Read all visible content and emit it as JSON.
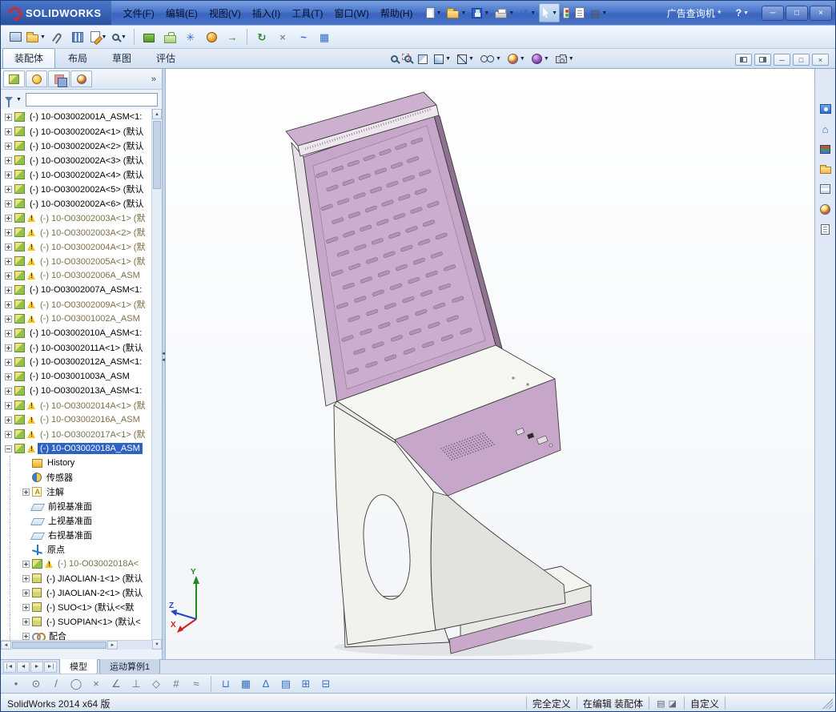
{
  "window": {
    "brand": "SOLIDWORKS",
    "doc_title": "广告查询机 *",
    "help_label": "?",
    "controls": [
      {
        "id": "minimize",
        "glyph": "─"
      },
      {
        "id": "maximize",
        "glyph": "□"
      },
      {
        "id": "close",
        "glyph": "×"
      }
    ]
  },
  "ui": {
    "dropdown_glyph": "▼",
    "arrow_up": "▲",
    "arrow_down": "▼",
    "arrow_left": "◄",
    "arrow_right": "►",
    "panel_overflow": "»"
  },
  "menubar": {
    "items": [
      {
        "id": "file",
        "label": "文件(F)"
      },
      {
        "id": "edit",
        "label": "编辑(E)"
      },
      {
        "id": "view",
        "label": "视图(V)"
      },
      {
        "id": "insert",
        "label": "插入(I)"
      },
      {
        "id": "tools",
        "label": "工具(T)"
      },
      {
        "id": "window",
        "label": "窗口(W)"
      },
      {
        "id": "help",
        "label": "帮助(H)"
      }
    ]
  },
  "quickbar": [
    {
      "id": "new-document",
      "icon": "new",
      "drop": true
    },
    {
      "id": "open",
      "icon": "open",
      "drop": true
    },
    {
      "id": "save",
      "icon": "save",
      "drop": true
    },
    {
      "id": "print",
      "icon": "print",
      "drop": true
    },
    {
      "id": "undo",
      "glyph": "↺",
      "tone": "blue",
      "drop": true
    },
    {
      "id": "select",
      "icon": "cursor",
      "drop": true,
      "pressed": true
    },
    {
      "id": "rebuild",
      "icon": "traffic"
    },
    {
      "id": "file-properties",
      "icon": "props"
    },
    {
      "id": "options",
      "glyph": "▤",
      "tone": "dark",
      "drop": true
    }
  ],
  "main_toolbar": [
    {
      "id": "new-window",
      "icon": "screen"
    },
    {
      "id": "open-document",
      "icon": "open",
      "drop": true
    },
    {
      "id": "attachment",
      "icon": "clip"
    },
    {
      "id": "snap-columns",
      "icon": "columns"
    },
    {
      "id": "edit-note",
      "icon": "note",
      "drop": true
    },
    {
      "id": "search",
      "icon": "mag",
      "drop": true
    },
    {
      "sep": true
    },
    {
      "id": "edrawings",
      "icon": "book"
    },
    {
      "id": "toolbox",
      "icon": "toolbox"
    },
    {
      "id": "wizard",
      "glyph": "✳",
      "tone": "blue"
    },
    {
      "id": "render",
      "icon": "ball-orange"
    },
    {
      "id": "motion",
      "glyph": "→",
      "tone": "green"
    },
    {
      "sep": true
    },
    {
      "id": "update",
      "glyph": "↻",
      "tone": "green"
    },
    {
      "id": "detach",
      "glyph": "×",
      "tone": "gray"
    },
    {
      "id": "routing",
      "glyph": "~",
      "tone": "blue"
    },
    {
      "id": "table-grid",
      "glyph": "▦",
      "tone": "blue"
    }
  ],
  "command_tabs": [
    {
      "label": "装配体",
      "active": true
    },
    {
      "label": "布局",
      "active": false
    },
    {
      "label": "草图",
      "active": false
    },
    {
      "label": "评估",
      "active": false
    }
  ],
  "headsup": [
    {
      "id": "zoom-fit",
      "icon": "mag"
    },
    {
      "id": "zoom-area",
      "icon": "magarea"
    },
    {
      "id": "section-view",
      "icon": "section"
    },
    {
      "id": "view-orientation",
      "icon": "cube",
      "drop": true
    },
    {
      "id": "display-style",
      "icon": "cubewire",
      "drop": true
    },
    {
      "id": "hide-show-items",
      "icon": "glasses",
      "drop": true
    },
    {
      "id": "edit-appearance",
      "icon": "ball",
      "drop": true
    },
    {
      "id": "apply-scene",
      "icon": "ball2",
      "drop": true
    },
    {
      "id": "view-settings",
      "icon": "cam",
      "drop": true
    }
  ],
  "viewport_controls": [
    {
      "id": "pane-left-toggle",
      "kind": "half-l"
    },
    {
      "id": "pane-right-toggle",
      "kind": "half-r"
    },
    {
      "id": "doc-minimize",
      "glyph": "─"
    },
    {
      "id": "doc-restore",
      "glyph": "□"
    },
    {
      "id": "doc-close",
      "glyph": "×"
    }
  ],
  "panel_tabs": [
    {
      "id": "featuremanager",
      "active": true
    },
    {
      "id": "propertymanager",
      "active": false
    },
    {
      "id": "configurationmanager",
      "active": false
    },
    {
      "id": "appearancemanager",
      "active": false
    }
  ],
  "filter": {
    "value": "",
    "placeholder": ""
  },
  "tree": {
    "items": [
      {
        "label": "(-) 10-O03002001A_ASM<1:",
        "icon": "asm",
        "exp": "plus",
        "indent": 0
      },
      {
        "label": "(-) 10-O03002002A<1> (默认",
        "icon": "asm",
        "exp": "plus",
        "indent": 0
      },
      {
        "label": "(-) 10-O03002002A<2> (默认",
        "icon": "asm",
        "exp": "plus",
        "indent": 0
      },
      {
        "label": "(-) 10-O03002002A<3> (默认",
        "icon": "asm",
        "exp": "plus",
        "indent": 0
      },
      {
        "label": "(-) 10-O03002002A<4> (默认",
        "icon": "asm",
        "exp": "plus",
        "indent": 0
      },
      {
        "label": "(-) 10-O03002002A<5> (默认",
        "icon": "asm",
        "exp": "plus",
        "indent": 0
      },
      {
        "label": "(-) 10-O03002002A<6> (默认",
        "icon": "asm",
        "exp": "plus",
        "indent": 0
      },
      {
        "label": "(-) 10-O03002003A<1> (默",
        "icon": "asm",
        "warn": true,
        "dim": true,
        "exp": "plus",
        "indent": 0
      },
      {
        "label": "(-) 10-O03002003A<2> (默",
        "icon": "asm",
        "warn": true,
        "dim": true,
        "exp": "plus",
        "indent": 0
      },
      {
        "label": "(-) 10-O03002004A<1> (默",
        "icon": "asm",
        "warn": true,
        "dim": true,
        "exp": "plus",
        "indent": 0
      },
      {
        "label": "(-) 10-O03002005A<1> (默",
        "icon": "asm",
        "warn": true,
        "dim": true,
        "exp": "plus",
        "indent": 0
      },
      {
        "label": "(-) 10-O03002006A_ASM",
        "icon": "asm",
        "warn": true,
        "dim": true,
        "exp": "plus",
        "indent": 0
      },
      {
        "label": "(-) 10-O03002007A_ASM<1:",
        "icon": "asm",
        "exp": "plus",
        "indent": 0
      },
      {
        "label": "(-) 10-O03002009A<1> (默",
        "icon": "asm",
        "warn": true,
        "dim": true,
        "exp": "plus",
        "indent": 0
      },
      {
        "label": "(-) 10-O03001002A_ASM",
        "icon": "asm",
        "warn": true,
        "dim": true,
        "exp": "plus",
        "indent": 0
      },
      {
        "label": "(-) 10-O03002010A_ASM<1:",
        "icon": "asm",
        "exp": "plus",
        "indent": 0
      },
      {
        "label": "(-) 10-O03002011A<1> (默认",
        "icon": "asm",
        "exp": "plus",
        "indent": 0
      },
      {
        "label": "(-) 10-O03002012A_ASM<1:",
        "icon": "asm",
        "exp": "plus",
        "indent": 0
      },
      {
        "label": "(-) 10-O03001003A_ASM",
        "icon": "asm",
        "exp": "plus",
        "indent": 0
      },
      {
        "label": "(-) 10-O03002013A_ASM<1:",
        "icon": "asm",
        "exp": "plus",
        "indent": 0
      },
      {
        "label": "(-) 10-O03002014A<1> (默",
        "icon": "asm",
        "warn": true,
        "dim": true,
        "exp": "plus",
        "indent": 0
      },
      {
        "label": "(-) 10-O03002016A_ASM",
        "icon": "asm",
        "warn": true,
        "dim": true,
        "exp": "plus",
        "indent": 0
      },
      {
        "label": "(-) 10-O03002017A<1> (默",
        "icon": "asm",
        "warn": true,
        "dim": true,
        "exp": "plus",
        "indent": 0
      },
      {
        "label": "(-) 10-O03002018A_ASM",
        "icon": "asm",
        "warn": true,
        "sel": true,
        "exp": "minus",
        "indent": 0
      },
      {
        "label": "History",
        "icon": "history",
        "indent": 1
      },
      {
        "label": "传感器",
        "icon": "sensor",
        "indent": 1
      },
      {
        "label": "注解",
        "icon": "annotation",
        "exp": "plus",
        "indent": 1
      },
      {
        "label": "前视基准面",
        "icon": "plane",
        "indent": 1
      },
      {
        "label": "上视基准面",
        "icon": "plane",
        "indent": 1
      },
      {
        "label": "右视基准面",
        "icon": "plane",
        "indent": 1
      },
      {
        "label": "原点",
        "icon": "origin",
        "indent": 1
      },
      {
        "label": "(-) 10-O03002018A<",
        "icon": "asm",
        "warn": true,
        "dim": true,
        "exp": "plus",
        "indent": 1
      },
      {
        "label": "(-) JIAOLIAN-1<1> (默认",
        "icon": "part",
        "exp": "plus",
        "indent": 1
      },
      {
        "label": "(-) JIAOLIAN-2<1> (默认",
        "icon": "part",
        "exp": "plus",
        "indent": 1
      },
      {
        "label": "(-) SUO<1> (默认<<默",
        "icon": "part",
        "exp": "plus",
        "indent": 1
      },
      {
        "label": "(-) SUOPIAN<1> (默认<",
        "icon": "part",
        "exp": "plus",
        "indent": 1
      },
      {
        "label": "配合",
        "icon": "mates",
        "exp": "plus",
        "indent": 1
      }
    ]
  },
  "taskpane": [
    {
      "id": "solidworks-resources",
      "kind": "res"
    },
    {
      "id": "home",
      "glyph": "⌂",
      "tone": "blue"
    },
    {
      "id": "design-library",
      "kind": "lib"
    },
    {
      "id": "file-explorer",
      "kind": "exp"
    },
    {
      "id": "view-palette",
      "kind": "pal"
    },
    {
      "id": "appearances",
      "kind": "ball"
    },
    {
      "id": "custom-properties",
      "kind": "prop"
    }
  ],
  "bottom_tabs": {
    "nav": [
      "|◄",
      "◄",
      "►",
      "►|"
    ],
    "tabs": [
      {
        "label": "模型",
        "active": true
      },
      {
        "label": "运动算例1",
        "active": false
      }
    ]
  },
  "sketchbar": [
    {
      "id": "sketch-point",
      "glyph": "•"
    },
    {
      "id": "sketch-circle",
      "glyph": "⊙"
    },
    {
      "id": "sketch-line",
      "glyph": "/"
    },
    {
      "id": "sketch-ellipse",
      "glyph": "◯"
    },
    {
      "id": "sketch-trim",
      "glyph": "×"
    },
    {
      "id": "sketch-angle",
      "glyph": "∠"
    },
    {
      "id": "sketch-perpendicular",
      "glyph": "⊥"
    },
    {
      "id": "sketch-polygon",
      "glyph": "◇"
    },
    {
      "id": "sketch-hatch",
      "glyph": "#"
    },
    {
      "id": "sketch-spline",
      "glyph": "≈"
    },
    {
      "sep": true
    },
    {
      "id": "stretch-entities",
      "glyph": "⊔",
      "blue": true
    },
    {
      "id": "grid-settings",
      "glyph": "▦",
      "blue": true
    },
    {
      "id": "draft-triangle",
      "glyph": "∆",
      "blue": true
    },
    {
      "id": "lines-view",
      "glyph": "▤",
      "blue": true
    },
    {
      "id": "add-table",
      "glyph": "⊞",
      "blue": true
    },
    {
      "id": "remove-table",
      "glyph": "⊟",
      "blue": true
    }
  ],
  "statusbar": {
    "app_version": "SolidWorks 2014 x64 版",
    "defined": "完全定义",
    "editing": "在编辑 装配体",
    "custom": "自定义",
    "icons": [
      {
        "id": "sheet-status",
        "glyph": "▤"
      },
      {
        "id": "selection-status",
        "glyph": "◪"
      }
    ]
  },
  "triad": {
    "x": "X",
    "y": "Y",
    "z": "Z"
  },
  "colors": {
    "titlebar": "#3f6fc4",
    "selection": "#2e63c4",
    "warning": "#f6c51e",
    "model_pink": "#c6a6c9",
    "model_pink_dark": "#8f7292",
    "model_white": "#f1f1ee",
    "model_gray": "#e2e2de"
  }
}
